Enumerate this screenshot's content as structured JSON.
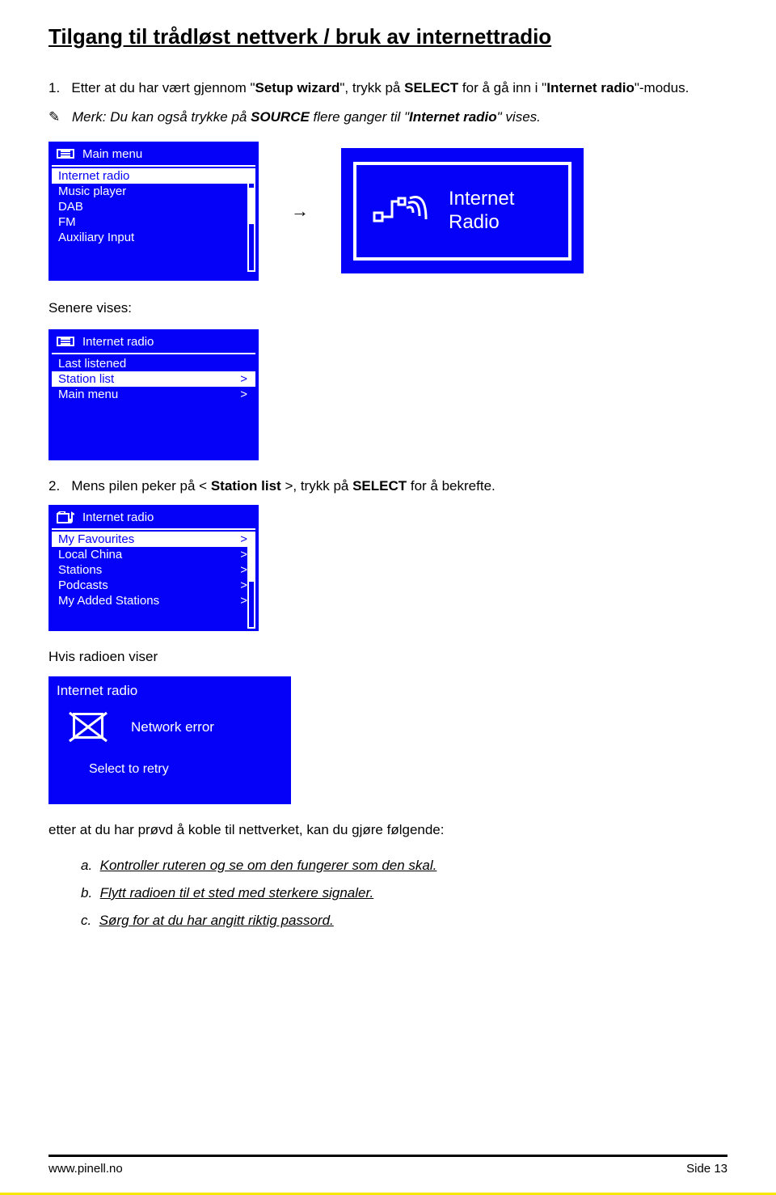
{
  "page_title": "Tilgang til trådløst nettverk / bruk av internettradio",
  "step1_num": "1.",
  "step1_a": "Etter at du har vært gjennom \"",
  "step1_b": "Setup wizard",
  "step1_c": "\", trykk på ",
  "step1_d": "SELECT",
  "step1_e": " for å gå inn i \"",
  "step1_f": "Internet radio",
  "step1_g": "\"-modus.",
  "note_prefix": "✎",
  "note_a": "Merk: Du kan også trykke på ",
  "note_b": "SOURCE",
  "note_c": " flere ganger til \"",
  "note_d": "Internet radio",
  "note_e": "\" vises.",
  "display1": {
    "header": "Main menu",
    "items": [
      "Internet radio",
      "Music player",
      "DAB",
      "FM",
      "Auxiliary Input"
    ],
    "selected": 0
  },
  "display2": {
    "line1": "Internet",
    "line2": "Radio"
  },
  "senere_vises": "Senere vises:",
  "display3": {
    "header": "Internet radio",
    "items": [
      {
        "label": "Last listened",
        "arrow": false
      },
      {
        "label": "Station list",
        "arrow": true
      },
      {
        "label": "Main menu",
        "arrow": true
      }
    ],
    "selected": 1
  },
  "step2_num": "2.",
  "step2_a": "Mens pilen peker på < ",
  "step2_b": "Station list",
  "step2_c": " >, trykk på ",
  "step2_d": "SELECT",
  "step2_e": " for å bekrefte.",
  "display4": {
    "header": "Internet radio",
    "items": [
      {
        "label": "My Favourites",
        "arrow": true
      },
      {
        "label": "Local China",
        "arrow": true
      },
      {
        "label": "Stations",
        "arrow": true
      },
      {
        "label": "Podcasts",
        "arrow": true
      },
      {
        "label": "My Added Stations",
        "arrow": true
      }
    ],
    "selected": 0
  },
  "hvis_radioen": "Hvis radioen viser",
  "display5": {
    "title": "Internet radio",
    "error": "Network error",
    "retry": "Select to retry"
  },
  "etter_text": "etter at du har prøvd å koble til nettverket, kan du gjøre følgende:",
  "sub_a_letter": "a.",
  "sub_a": "Kontroller ruteren og se om den fungerer som den skal.",
  "sub_b_letter": "b.",
  "sub_b": "Flytt radioen til et sted med sterkere signaler.",
  "sub_c_letter": "c.",
  "sub_c": "Sørg for at du har angitt riktig passord.",
  "footer_left": "www.pinell.no",
  "footer_right": "Side 13"
}
